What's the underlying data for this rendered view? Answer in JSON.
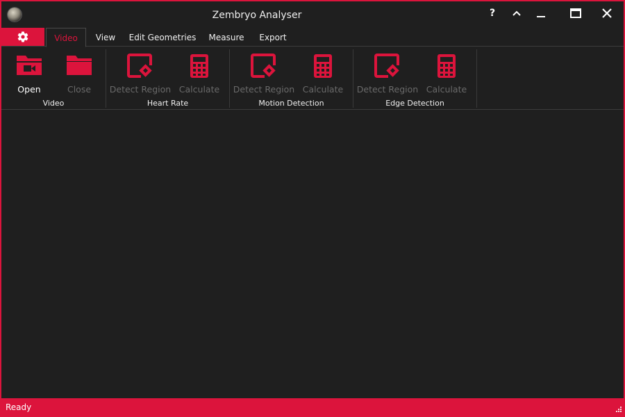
{
  "window": {
    "title": "Zembryo Analyser"
  },
  "titlebar": {
    "help_icon": "question-mark",
    "ribbon_toggle_icon": "chevron-up",
    "minimize_icon": "minimize",
    "maximize_icon": "maximize",
    "close_icon": "close"
  },
  "tabs": {
    "settings_icon": "gear",
    "items": [
      {
        "label": "Video",
        "active": true
      },
      {
        "label": "View"
      },
      {
        "label": "Edit Geometries"
      },
      {
        "label": "Measure"
      },
      {
        "label": "Export"
      }
    ]
  },
  "ribbon": {
    "groups": [
      {
        "label": "Video",
        "buttons": [
          {
            "label": "Open",
            "icon": "video-folder",
            "enabled": true
          },
          {
            "label": "Close",
            "icon": "folder",
            "enabled": false
          }
        ]
      },
      {
        "label": "Heart Rate",
        "buttons": [
          {
            "label": "Detect Region",
            "icon": "detect-region",
            "enabled": false
          },
          {
            "label": "Calculate",
            "icon": "calculator",
            "enabled": false
          }
        ]
      },
      {
        "label": "Motion Detection",
        "buttons": [
          {
            "label": "Detect Region",
            "icon": "detect-region",
            "enabled": false
          },
          {
            "label": "Calculate",
            "icon": "calculator",
            "enabled": false
          }
        ]
      },
      {
        "label": "Edge Detection",
        "buttons": [
          {
            "label": "Detect Region",
            "icon": "detect-region",
            "enabled": false
          },
          {
            "label": "Calculate",
            "icon": "calculator",
            "enabled": false
          }
        ]
      }
    ]
  },
  "status": {
    "text": "Ready"
  },
  "colors": {
    "accent": "#dc143c",
    "background": "#1f1f1f",
    "disabled_text": "#6a6a6a",
    "text": "#f0f0f0"
  }
}
